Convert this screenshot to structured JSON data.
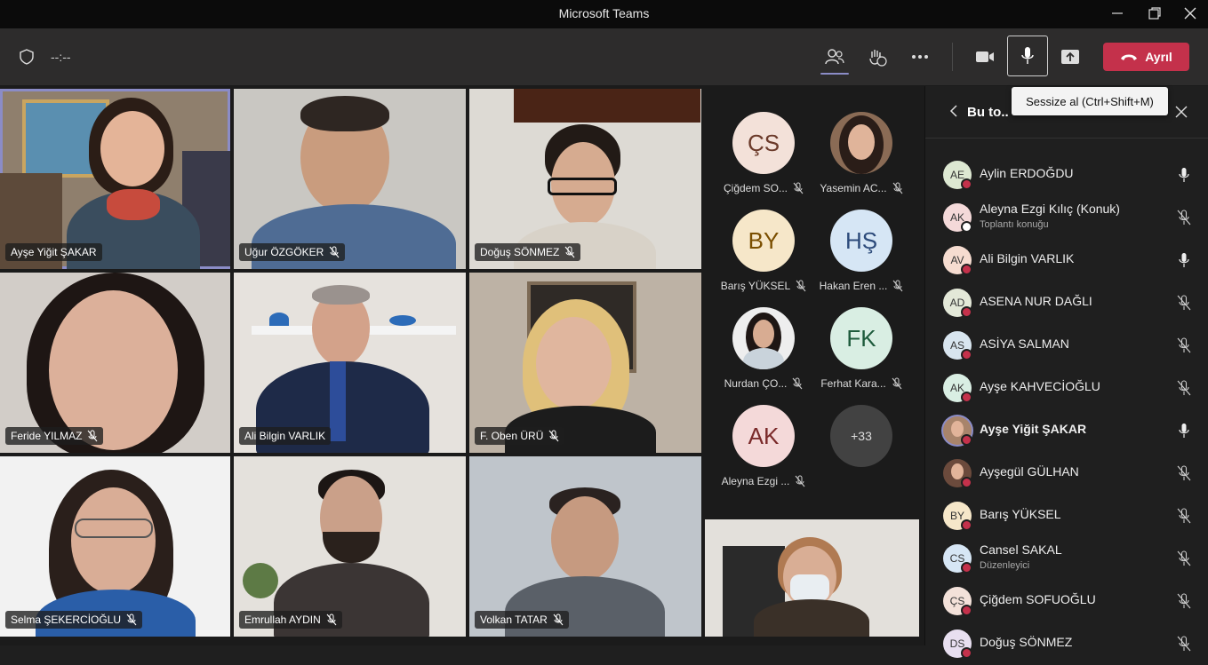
{
  "window": {
    "title": "Microsoft Teams"
  },
  "toolbar": {
    "timer": "--:--",
    "leave_label": "Ayrıl"
  },
  "tooltip": {
    "text": "Sessize al (Ctrl+Shift+M)"
  },
  "panel": {
    "title": "Bu to.."
  },
  "tiles": [
    {
      "name": "Ayşe Yiğit ŞAKAR",
      "muted": false
    },
    {
      "name": "Uğur ÖZGÖKER",
      "muted": true
    },
    {
      "name": "Doğuş SÖNMEZ",
      "muted": true
    },
    {
      "name": "Feride YILMAZ",
      "muted": true
    },
    {
      "name": "Ali Bilgin VARLIK",
      "muted": false
    },
    {
      "name": "F. Oben ÜRÜ",
      "muted": true
    },
    {
      "name": "Selma ŞEKERCİOĞLU",
      "muted": true
    },
    {
      "name": "Emrullah AYDIN",
      "muted": true
    },
    {
      "name": "Volkan TATAR",
      "muted": true
    }
  ],
  "roster": [
    {
      "initials": "ÇS",
      "name": "Çiğdem SO...",
      "bg": "#f3e1d9",
      "fg": "#6b3a2a",
      "muted": true
    },
    {
      "initials": "",
      "name": "Yasemin AC...",
      "bg": "#8a6b55",
      "fg": "#fff",
      "muted": true,
      "photo": true
    },
    {
      "initials": "BY",
      "name": "Barış YÜKSEL",
      "bg": "#f6e7c9",
      "fg": "#7a4e00",
      "muted": true
    },
    {
      "initials": "HŞ",
      "name": "Hakan Eren ...",
      "bg": "#d6e6f5",
      "fg": "#2c4a7a",
      "muted": true
    },
    {
      "initials": "",
      "name": "Nurdan ÇO...",
      "bg": "#e8e8e8",
      "fg": "#333",
      "muted": true,
      "photo": true
    },
    {
      "initials": "FK",
      "name": "Ferhat Kara...",
      "bg": "#d9eee3",
      "fg": "#1e5b3c",
      "muted": true
    },
    {
      "initials": "AK",
      "name": "Aleyna Ezgi ...",
      "bg": "#f4d9d9",
      "fg": "#7a2a2a",
      "muted": true
    },
    {
      "initials": "+33",
      "name": "",
      "bg": "#424242",
      "fg": "#ddd",
      "muted": false
    }
  ],
  "participants": [
    {
      "initials": "AE",
      "name": "Aylin ERDOĞDU",
      "sub": "",
      "bg": "#dde8d2",
      "muted": false,
      "bold": false
    },
    {
      "initials": "AK",
      "name": "Aleyna Ezgi Kılıç (Konuk)",
      "sub": "Toplantı konuğu",
      "bg": "#f4d9d9",
      "muted": true,
      "bold": false,
      "guest": true
    },
    {
      "initials": "AV",
      "name": "Ali Bilgin VARLIK",
      "sub": "",
      "bg": "#f6dcd0",
      "muted": false,
      "bold": false
    },
    {
      "initials": "AD",
      "name": "ASENA NUR DAĞLI",
      "sub": "",
      "bg": "#e3e8d8",
      "muted": true,
      "bold": false
    },
    {
      "initials": "AS",
      "name": "ASİYA SALMAN",
      "sub": "",
      "bg": "#d8e5ef",
      "muted": true,
      "bold": false
    },
    {
      "initials": "AK",
      "name": "Ayşe KAHVECİOĞLU",
      "sub": "",
      "bg": "#d9eee3",
      "muted": true,
      "bold": false
    },
    {
      "initials": "",
      "name": "Ayşe Yiğit ŞAKAR",
      "sub": "",
      "bg": "#a8846b",
      "muted": false,
      "bold": true,
      "photo": true
    },
    {
      "initials": "",
      "name": "Ayşegül GÜLHAN",
      "sub": "",
      "bg": "#6b4a3c",
      "muted": true,
      "bold": false,
      "photo": true
    },
    {
      "initials": "BY",
      "name": "Barış YÜKSEL",
      "sub": "",
      "bg": "#f6e7c9",
      "muted": true,
      "bold": false
    },
    {
      "initials": "CS",
      "name": "Cansel SAKAL",
      "sub": "Düzenleyici",
      "bg": "#d6e6f5",
      "muted": true,
      "bold": false
    },
    {
      "initials": "ÇS",
      "name": "Çiğdem SOFUOĞLU",
      "sub": "",
      "bg": "#f3e1d9",
      "muted": true,
      "bold": false
    },
    {
      "initials": "DS",
      "name": "Doğuş SÖNMEZ",
      "sub": "",
      "bg": "#e8dff0",
      "muted": true,
      "bold": false
    }
  ]
}
